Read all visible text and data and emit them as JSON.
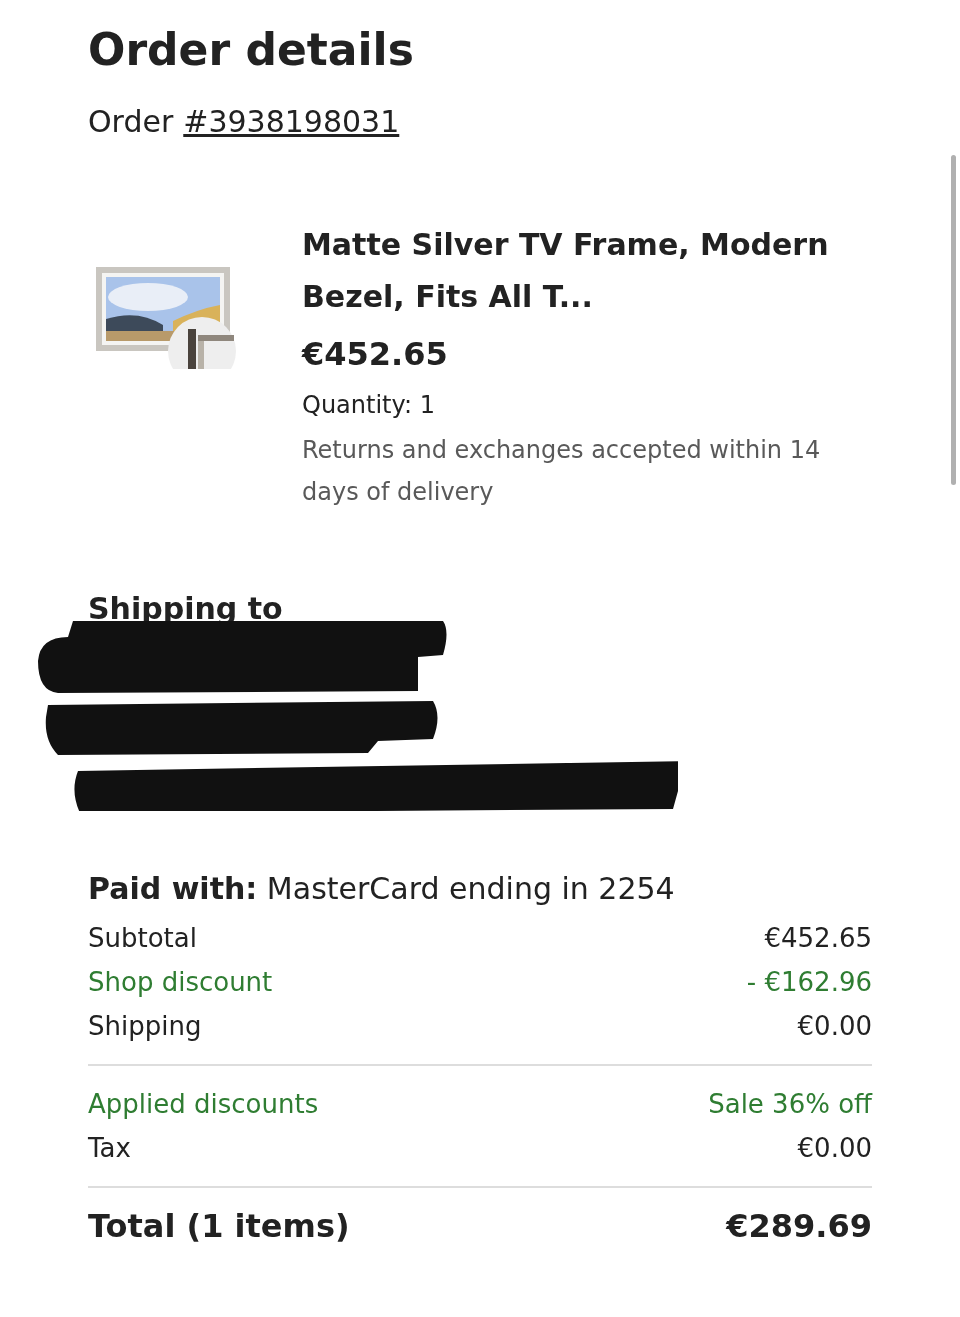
{
  "title": "Order details",
  "order": {
    "label": "Order",
    "number": "#3938198031"
  },
  "item": {
    "kind": "picture",
    "name": "Matte Silver TV Frame, Modern Bezel, Fits All T...",
    "price": "€452.65",
    "quantity": "Quantity: 1",
    "returns": "Returns and exchanges accepted within 14 days of delivery"
  },
  "shipping": {
    "heading": "Shipping to"
  },
  "payment": {
    "label": "Paid with:",
    "method": "MasterCard ending in 2254"
  },
  "groups": [
    [
      {
        "label": "Subtotal",
        "value": "€452.65",
        "kind": "plain"
      },
      {
        "label": "Shop discount",
        "value": "- €162.96",
        "kind": "discount"
      },
      {
        "label": "Shipping",
        "value": "€0.00",
        "kind": "plain"
      }
    ],
    [
      {
        "label": "Applied discounts",
        "value": "Sale 36% off",
        "kind": "discount"
      },
      {
        "label": "Tax",
        "value": "€0.00",
        "kind": "plain"
      }
    ]
  ],
  "total": {
    "label": "Total (1 items)",
    "value": "€289.69"
  }
}
